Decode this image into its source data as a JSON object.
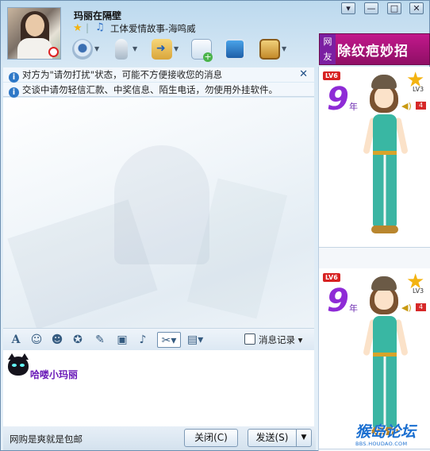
{
  "contact": {
    "nickname": "玛丽在隔壁",
    "signature": "工体爱情故事-海鸣威"
  },
  "window_controls": {
    "menu": "▾",
    "minimize": "—",
    "maximize": "□",
    "close": "✕"
  },
  "toolbar": {
    "items": [
      {
        "name": "webcam-icon"
      },
      {
        "name": "microphone-icon"
      },
      {
        "name": "send-file-icon"
      },
      {
        "name": "new-discussion-icon"
      },
      {
        "name": "remote-assist-icon"
      },
      {
        "name": "app-icon"
      }
    ]
  },
  "ad_banner": {
    "tag": "网友",
    "text": "除纹疤妙招"
  },
  "notices": {
    "first": "对方为\"请勿打扰\"状态，可能不方便接收您的消息",
    "second": "交谈中请勿轻信汇款、中奖信息、陌生电话，勿使用外挂软件。"
  },
  "format_toolbar": {
    "history_label": "消息记录"
  },
  "input": {
    "text": "哈喽小玛丽"
  },
  "bottom_bar": {
    "ad_text": "网购是爽就是包邮",
    "close_label": "关闭(C)",
    "send_label": "发送(S)"
  },
  "show_panel": {
    "cards": [
      {
        "level": "LV6",
        "years": "9",
        "years_unit": "年",
        "star_level": "LV3",
        "count": "4"
      },
      {
        "level": "LV6",
        "years": "9",
        "years_unit": "年",
        "star_level": "LV3",
        "count": "4"
      }
    ]
  },
  "watermark": {
    "text": "猴岛论坛",
    "url": "BBS.HOUDAO.COM"
  }
}
